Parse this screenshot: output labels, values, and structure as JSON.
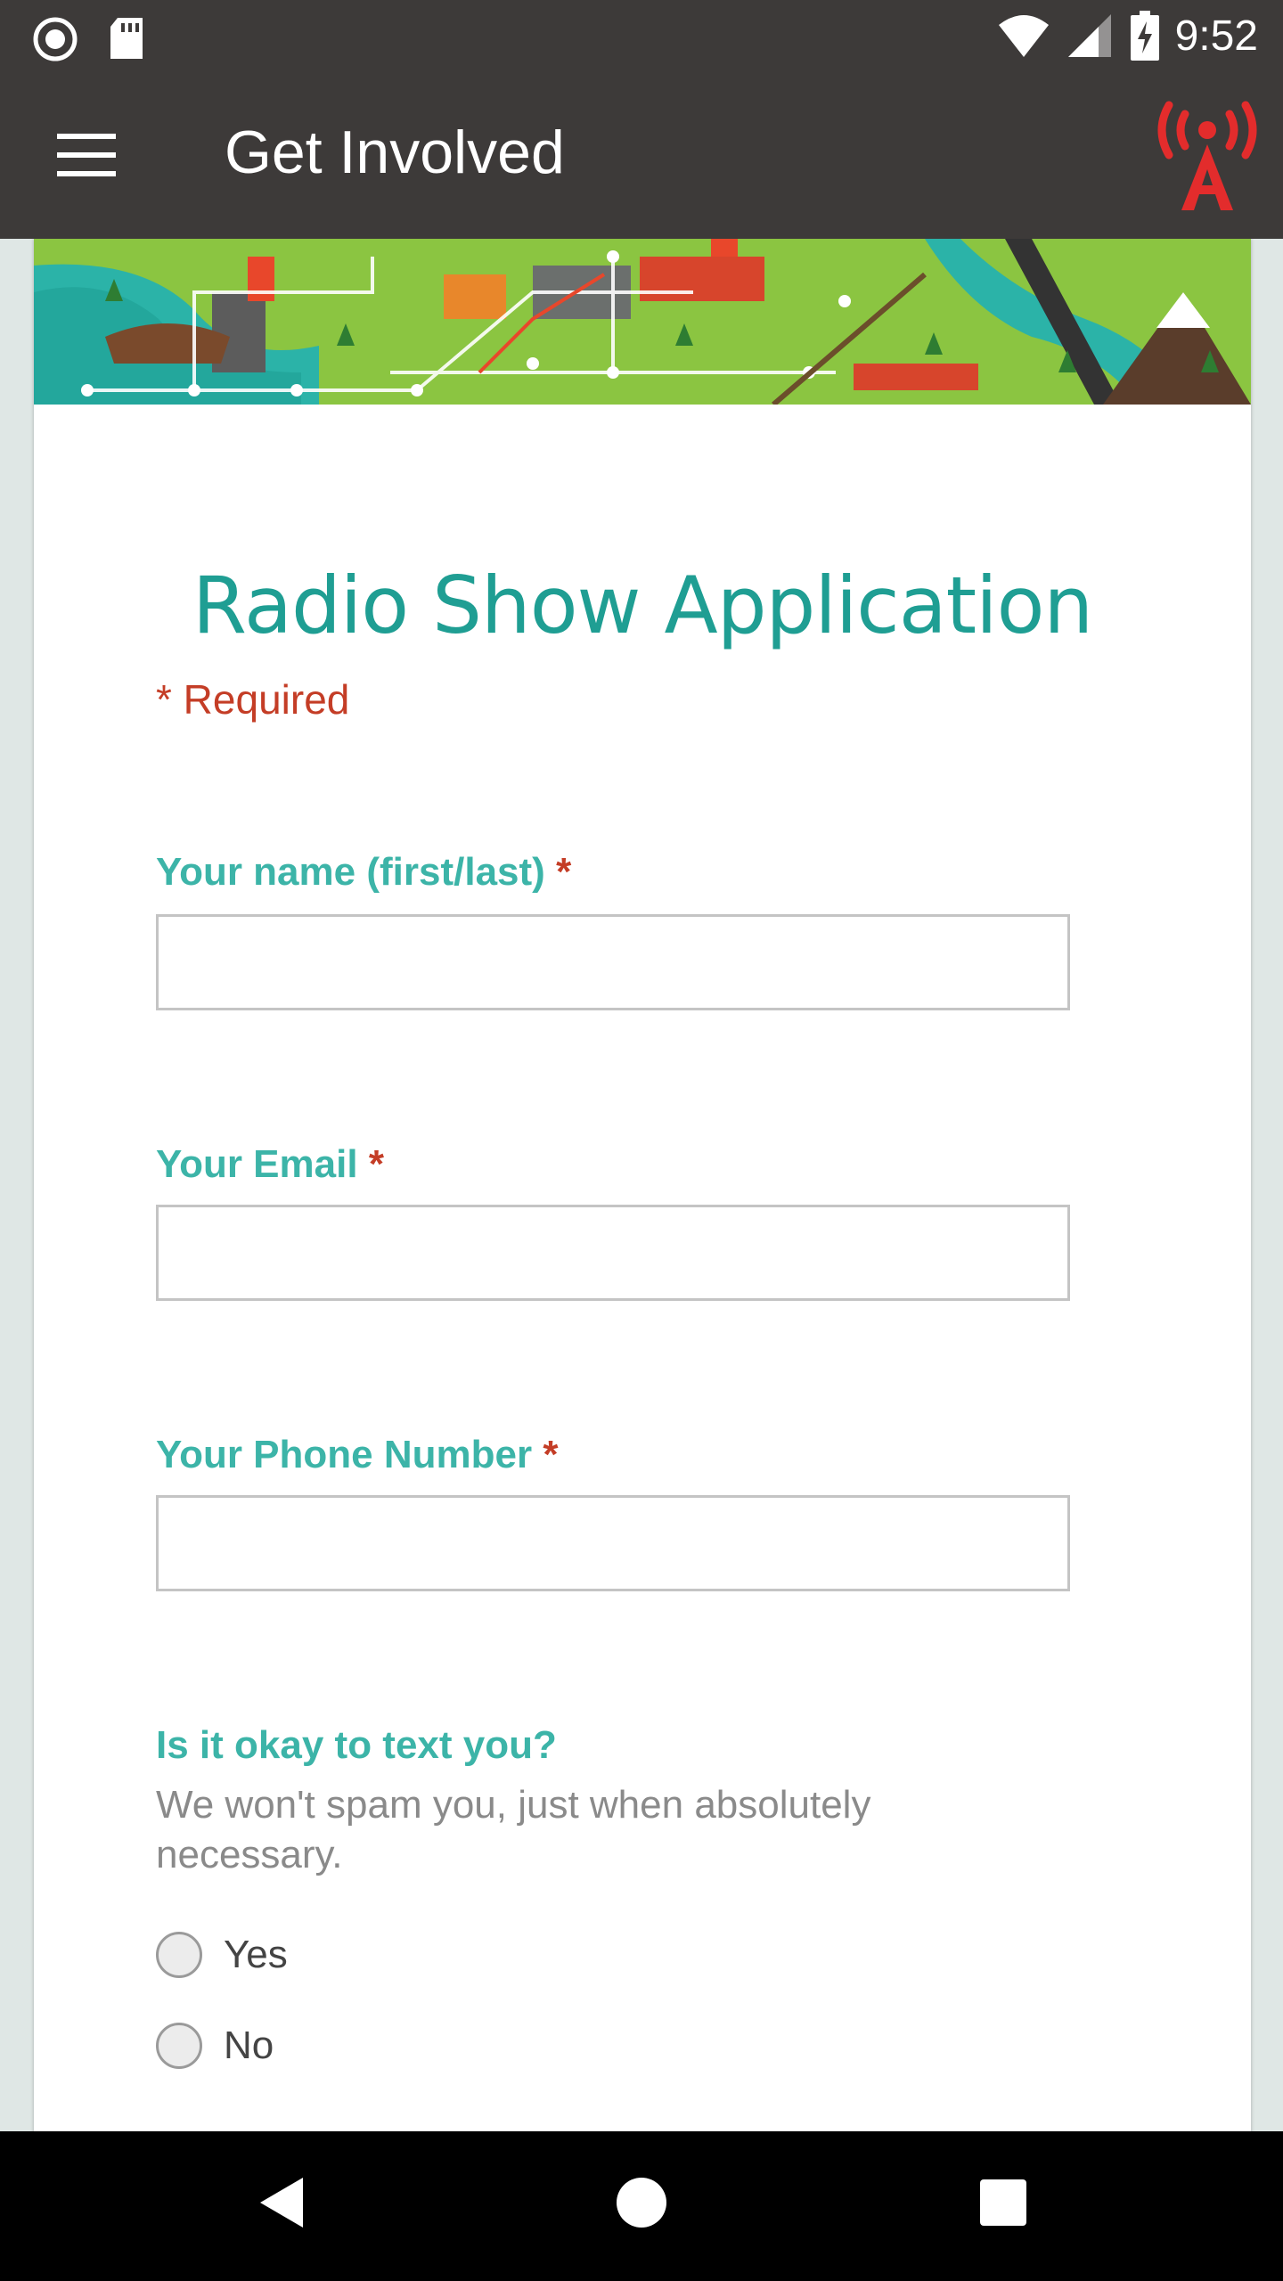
{
  "status_bar": {
    "time": "9:52",
    "icons": [
      "record-icon",
      "sd-card-icon",
      "wifi-icon",
      "cell-signal-icon",
      "battery-charging-icon"
    ]
  },
  "app_bar": {
    "title": "Get Involved",
    "menu_icon": "hamburger-menu-icon",
    "logo_icon": "radio-tower-logo-icon",
    "background": "#3d3a39",
    "logo_color": "#e32c2c"
  },
  "form": {
    "title": "Radio Show Application",
    "required_note": "* Required",
    "title_color": "#1f9e93",
    "label_color": "#3cb4a8",
    "required_color": "#c43d26",
    "questions": [
      {
        "label": "Your name (first/last)",
        "required_mark": "*",
        "value": ""
      },
      {
        "label": "Your Email",
        "required_mark": "*",
        "value": ""
      },
      {
        "label": "Your Phone Number",
        "required_mark": "*",
        "value": ""
      }
    ],
    "text_question": {
      "label": "Is it okay to text you?",
      "help": "We won't spam you, just when absolutely necessary.",
      "options": [
        "Yes",
        "No"
      ]
    }
  },
  "nav_bar": {
    "icons": [
      "back-triangle-icon",
      "home-circle-icon",
      "recents-square-icon"
    ]
  }
}
